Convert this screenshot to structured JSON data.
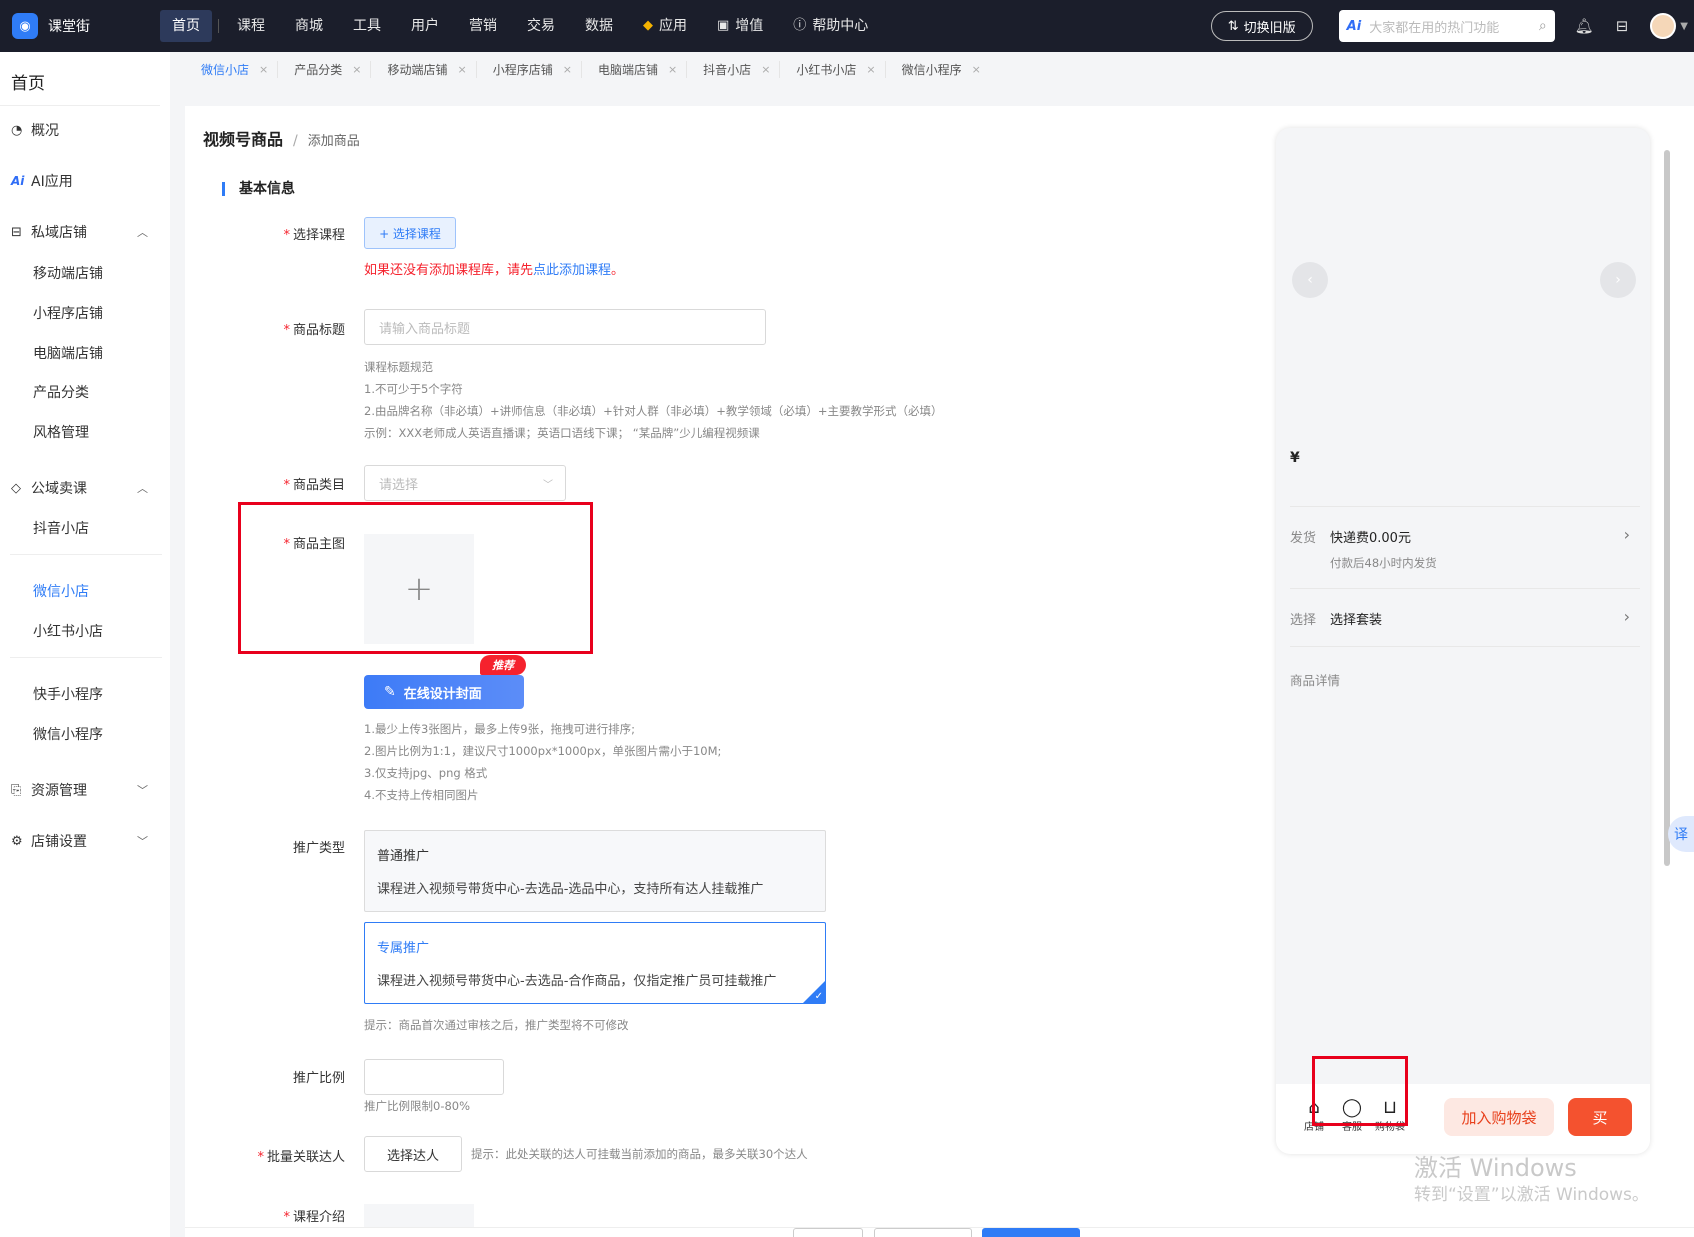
{
  "app": {
    "name": "课堂街"
  },
  "topnav": {
    "items": [
      "首页",
      "课程",
      "商城",
      "工具",
      "用户",
      "营销",
      "交易",
      "数据"
    ],
    "app_item": "应用",
    "value_item": "增值",
    "help_item": "帮助中心",
    "switch_label": "切换旧版",
    "search_placeholder": "大家都在用的热门功能",
    "search_ai": "Ai"
  },
  "sidebar": {
    "title": "首页",
    "overview": "概况",
    "ai_app": "AI应用",
    "ai_prefix": "Ai",
    "private_store": "私域店铺",
    "private_items": [
      "移动端店铺",
      "小程序店铺",
      "电脑端店铺",
      "产品分类",
      "风格管理"
    ],
    "public_course": "公域卖课",
    "public_items": [
      "抖音小店"
    ],
    "wx_items": [
      "微信小店",
      "小红书小店"
    ],
    "mini_items": [
      "快手小程序",
      "微信小程序"
    ],
    "resource": "资源管理",
    "store_settings": "店铺设置"
  },
  "tabs": [
    "微信小店",
    "产品分类",
    "移动端店铺",
    "小程序店铺",
    "电脑端店铺",
    "抖音小店",
    "小红书小店",
    "微信小程序"
  ],
  "breadcrumb": {
    "main": "视频号商品",
    "sep": "/",
    "sub": "添加商品"
  },
  "form": {
    "section_title": "基本信息",
    "select_course_label": "选择课程",
    "select_course_btn": "+ 选择课程",
    "warn_text": "如果还没有添加课程库，请先",
    "warn_link": "点此添加课程",
    "warn_end": "。",
    "title_label": "商品标题",
    "title_placeholder": "请输入商品标题",
    "title_rules": [
      "课程标题规范",
      "1.不可少于5个字符",
      "2.由品牌名称（非必填）+讲师信息（非必填）+针对人群（非必填）+教学领域（必填）+主要教学形式（必填）",
      "示例：XXX老师成人英语直播课；英语口语线下课； “某品牌”少儿编程视频课"
    ],
    "category_label": "商品类目",
    "category_placeholder": "请选择",
    "main_image_label": "商品主图",
    "design_btn": "在线设计封面",
    "badge": "推荐",
    "image_rules": [
      "1.最少上传3张图片，最多上传9张，拖拽可进行排序;",
      "2.图片比例为1:1，建议尺寸1000px*1000px，单张图片需小于10M;",
      "3.仅支持jpg、png 格式",
      "4.不支持上传相同图片"
    ],
    "promo_label": "推广类型",
    "promo_normal_title": "普通推广",
    "promo_normal_desc": "课程进入视频号带货中心-去选品-选品中心，支持所有达人挂载推广",
    "promo_exclusive_title": "专属推广",
    "promo_exclusive_desc": "课程进入视频号带货中心-去选品-合作商品，仅指定推广员可挂载推广",
    "promo_hint": "提示：商品首次通过审核之后，推广类型将不可修改",
    "ratio_label": "推广比例",
    "ratio_hint": "推广比例限制0-80%",
    "influencer_label": "批量关联达人",
    "influencer_btn": "选择达人",
    "influencer_hint": "提示：此处关联的达人可挂载当前添加的商品，最多关联30个达人",
    "intro_label": "课程介绍"
  },
  "preview": {
    "price_symbol": "¥",
    "ship_key": "发货",
    "ship_value": "快递费0.00元",
    "ship_sub": "付款后48小时内发货",
    "choose_key": "选择",
    "choose_value": "选择套装",
    "detail": "商品详情",
    "icon_store": "店铺",
    "icon_service": "客服",
    "icon_cart": "购物袋",
    "add_cart": "加入购物袋",
    "buy": "买"
  },
  "translate": "译",
  "watermark": {
    "line1": "激活 Windows",
    "line2": "转到“设置”以激活 Windows。"
  }
}
